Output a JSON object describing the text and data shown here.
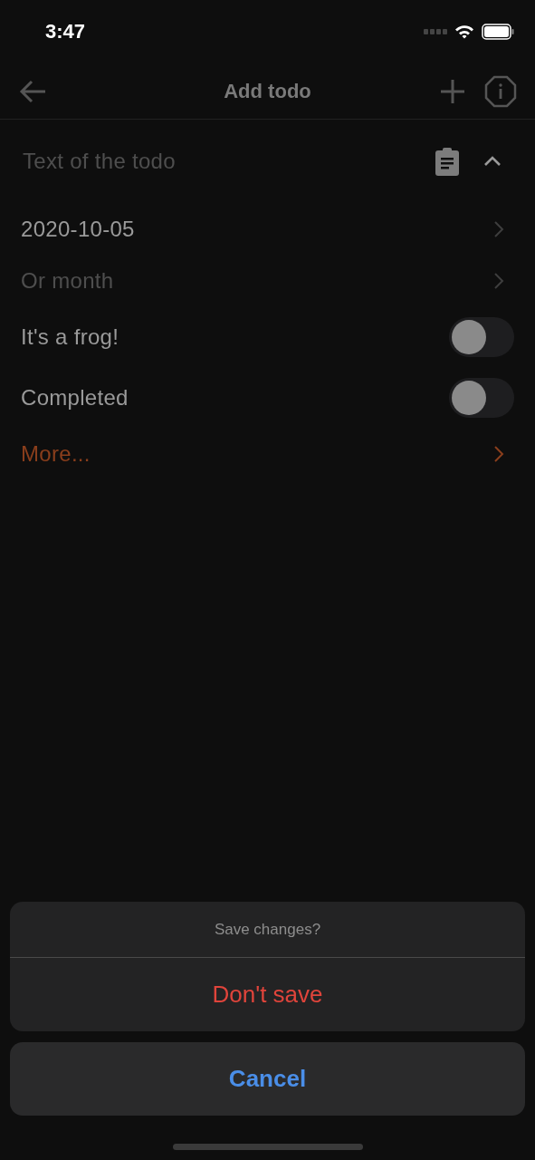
{
  "status_bar": {
    "time": "3:47"
  },
  "header": {
    "title": "Add todo"
  },
  "rows": [
    {
      "kind": "field",
      "placeholder": "Text of the todo",
      "expanded": true
    },
    {
      "kind": "nav",
      "value": "2020-10-05"
    },
    {
      "kind": "nav",
      "placeholder": "Or month"
    },
    {
      "kind": "toggle",
      "label": "It's a frog!",
      "on": false
    },
    {
      "kind": "toggle",
      "label": "Completed",
      "on": false
    },
    {
      "kind": "link",
      "label": "More..."
    }
  ],
  "action_sheet": {
    "title": "Save changes?",
    "actions": [
      {
        "label": "Don't save",
        "kind": "destructive"
      }
    ],
    "cancel": "Cancel"
  }
}
